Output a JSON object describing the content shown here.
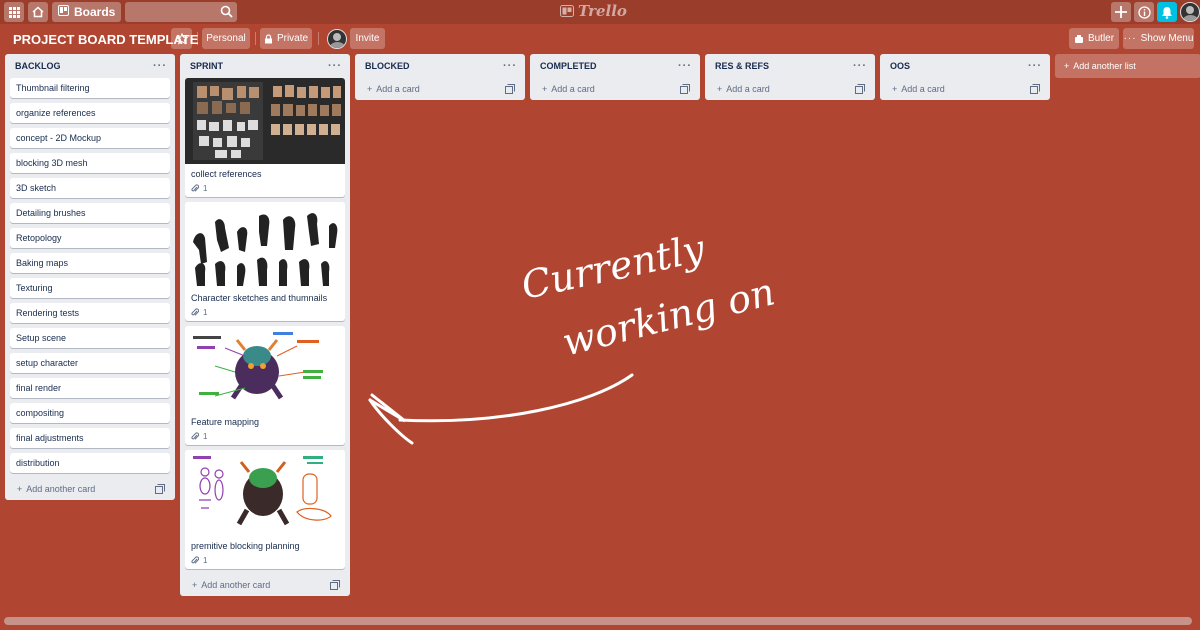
{
  "header": {
    "boards_label": "Boards",
    "logo_text": "Trello"
  },
  "board": {
    "title": "PROJECT BOARD TEMPLATE",
    "personal_label": "Personal",
    "private_label": "Private",
    "invite_label": "Invite",
    "butler_label": "Butler",
    "show_menu_label": "Show Menu"
  },
  "lists": [
    {
      "title": "BACKLOG",
      "cards": [
        "Thumbnail filtering",
        "organize references",
        "concept - 2D Mockup",
        "blocking 3D mesh",
        "3D sketch",
        "Detailing brushes",
        "Retopology",
        "Baking maps",
        "Texturing",
        "Rendering tests",
        "Setup scene",
        "setup character",
        "final render",
        "compositing",
        "final adjustments",
        "distribution"
      ],
      "add_label": "Add another card"
    },
    {
      "title": "SPRINT",
      "cards": [
        {
          "title": "collect references",
          "attachments": "1"
        },
        {
          "title": "Character sketches and thumnails",
          "attachments": "1"
        },
        {
          "title": "Feature mapping",
          "attachments": "1"
        },
        {
          "title": "premitive blocking planning",
          "attachments": "1"
        }
      ],
      "add_label": "Add another card"
    },
    {
      "title": "BLOCKED",
      "add_label": "Add a card"
    },
    {
      "title": "COMPLETED",
      "add_label": "Add a card"
    },
    {
      "title": "RES & REFS",
      "add_label": "Add a card"
    },
    {
      "title": "OOS",
      "add_label": "Add a card"
    }
  ],
  "add_list_label": "Add another list",
  "annotation": {
    "line1": "Currently",
    "line2": "working on"
  },
  "icons": [
    "apps-icon",
    "home-icon",
    "boards-icon",
    "search-icon",
    "plus-icon",
    "info-icon",
    "bell-icon",
    "star-icon",
    "lock-icon",
    "paperclip-icon",
    "card-template-icon",
    "more-icon"
  ],
  "colors": {
    "background": "#b04632",
    "topbar": "#9a3d2b",
    "list": "#ebecf0",
    "notification": "#00c2e0"
  }
}
